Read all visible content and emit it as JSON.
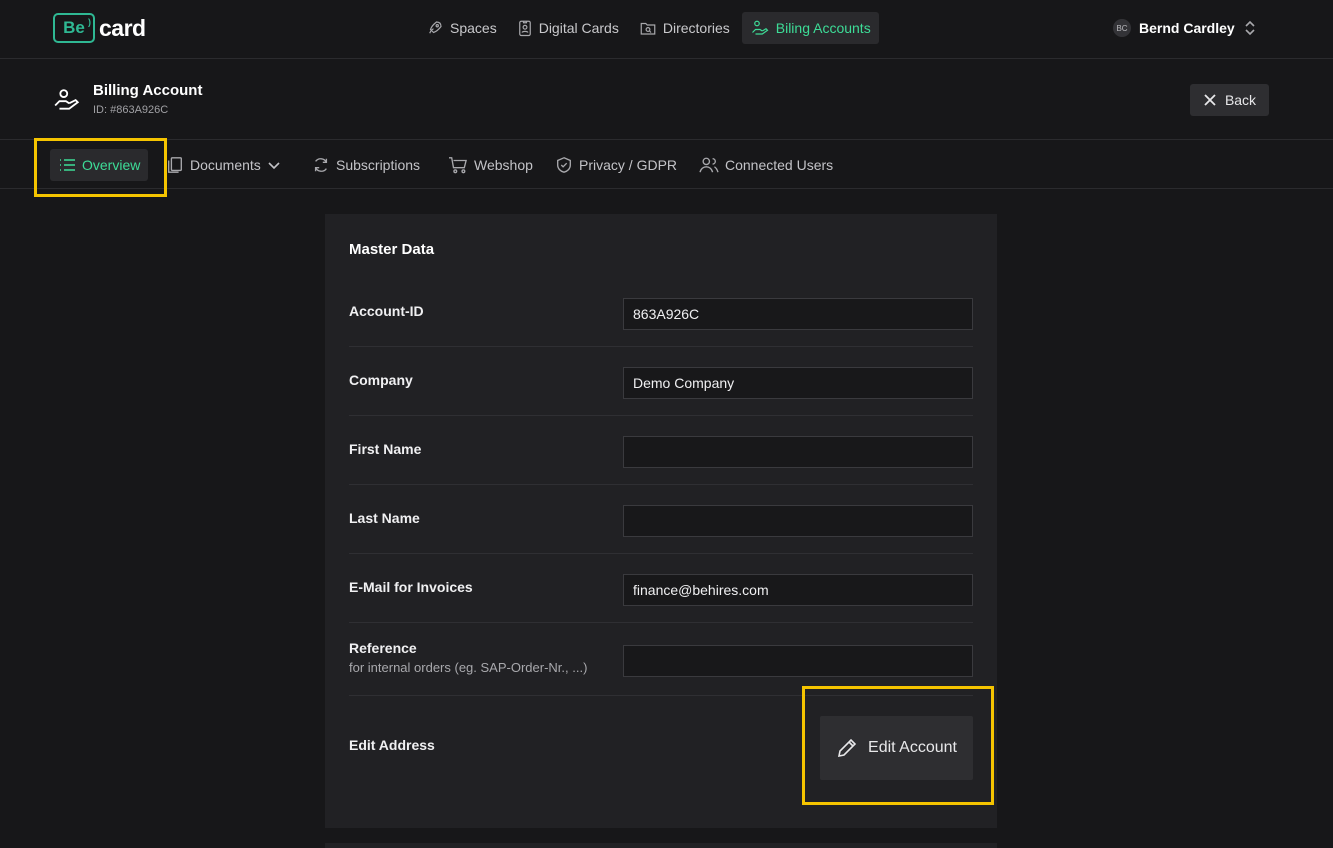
{
  "app": {
    "logo_mark": "Be",
    "logo_text": "card"
  },
  "nav": {
    "items": [
      {
        "label": "Spaces",
        "icon": "rocket-icon",
        "active": false
      },
      {
        "label": "Digital Cards",
        "icon": "id-badge-icon",
        "active": false
      },
      {
        "label": "Directories",
        "icon": "directory-icon",
        "active": false
      },
      {
        "label": "Biling Accounts",
        "icon": "billing-hand-icon",
        "active": true
      }
    ]
  },
  "user": {
    "initials": "BC",
    "name": "Bernd Cardley"
  },
  "page": {
    "title": "Billing Account",
    "id_text": "ID: #863A926C",
    "back_label": "Back"
  },
  "tabs": [
    {
      "label": "Overview",
      "icon": "list-icon",
      "active": true
    },
    {
      "label": "Documents",
      "icon": "documents-icon",
      "active": false
    },
    {
      "label": "Subscriptions",
      "icon": "refresh-icon",
      "active": false
    },
    {
      "label": "Webshop",
      "icon": "cart-icon",
      "active": false
    },
    {
      "label": "Privacy / GDPR",
      "icon": "shield-icon",
      "active": false
    },
    {
      "label": "Connected Users",
      "icon": "users-icon",
      "active": false
    }
  ],
  "master_data": {
    "title": "Master Data",
    "fields": [
      {
        "label": "Account-ID",
        "value": "863A926C"
      },
      {
        "label": "Company",
        "value": "Demo Company"
      },
      {
        "label": "First Name",
        "value": ""
      },
      {
        "label": "Last Name",
        "value": ""
      },
      {
        "label": "E-Mail for Invoices",
        "value": "finance@behires.com"
      },
      {
        "label": "Reference",
        "sublabel": "for internal orders (eg. SAP-Order-Nr., ...)",
        "value": ""
      }
    ],
    "edit_address_label": "Edit Address",
    "edit_account_label": "Edit Account"
  },
  "colors": {
    "accent": "#3ddc97",
    "highlight": "#f5c400",
    "background": "#171719",
    "card": "#212124"
  }
}
